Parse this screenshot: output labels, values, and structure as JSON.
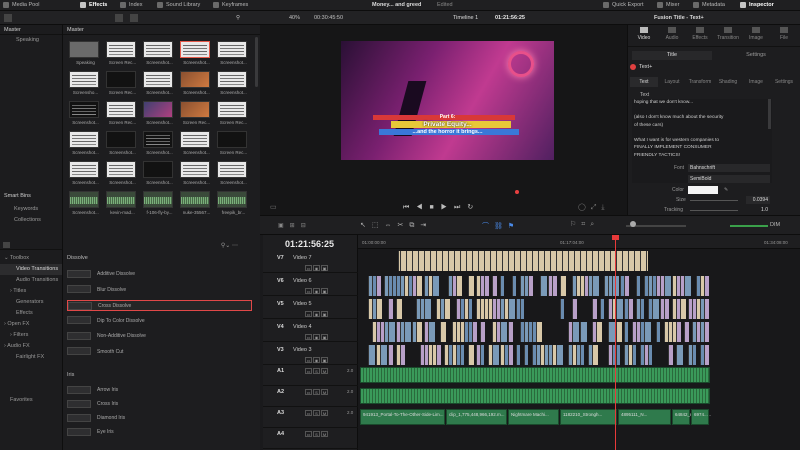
{
  "topbar": {
    "media_pool": "Media Pool",
    "effects": "Effects",
    "index": "Index",
    "sound_library": "Sound Library",
    "keyframes": "Keyframes",
    "project_title": "Money... and greed",
    "edited": "Edited",
    "quick_export": "Quick Export",
    "mixer": "Mixer",
    "metadata": "Metadata",
    "inspector": "Inspector"
  },
  "secbar": {
    "zoom": "40%",
    "timecode_left": "00:30:45:50",
    "timeline_name": "Timeline 1",
    "timecode_right": "01:21:56:25",
    "inspector_title": "Fusion Title - Text+"
  },
  "bins": {
    "master_header": "Master",
    "speaking": "Speaking",
    "smart_bins": "Smart Bins",
    "keywords": "Keywords",
    "collections": "Collections"
  },
  "pool": {
    "header": "Master",
    "clips": [
      "Speaking",
      "Screen Rec...",
      "Screenshot...",
      "Screenshot...",
      "Screenshot...",
      "Screensho...",
      "Screen Rec...",
      "Screenshot...",
      "Screenshot...",
      "Screenshot...",
      "Screenshot...",
      "Screen Rec...",
      "Screenshot...",
      "Screen Rec...",
      "Screen Rec...",
      "Screenshot...",
      "Screenshot...",
      "Screenshot...",
      "Screenshot...",
      "Screen Rec...",
      "Screenshot...",
      "Screenshot...",
      "Screenshot...",
      "Screenshot...",
      "Screenshot...",
      "Screenshot...",
      "kevin-mad...",
      "f-106-fly-by...",
      "nuke-35567...",
      "freepik_br..."
    ]
  },
  "viewer": {
    "line1": "Part 6:",
    "line2": "Private Equity...",
    "line3": "...and the horror it brings..."
  },
  "inspector": {
    "tabs": [
      "Video",
      "Audio",
      "Effects",
      "Transition",
      "Image",
      "File"
    ],
    "subtabs": [
      "Title",
      "Settings"
    ],
    "node_name": "Text+",
    "text_tabs": [
      "Text",
      "Layout",
      "Transform",
      "Shading",
      "Image",
      "Settings"
    ],
    "section": "Text",
    "body_lines": [
      "hoping that we don't know...",
      "",
      "(also I don't know much about the security",
      "of these cars)",
      "",
      "What I want is for western companies to",
      "FINALLY IMPLEMENT CONSUMER",
      "FRIENDLY TACTICS!"
    ],
    "font_label": "Font",
    "font_value": "Bahnschrift",
    "style_value": "SemiBold",
    "color_label": "Color",
    "size_label": "Size",
    "size_value": "0.0394",
    "tracking_label": "Tracking",
    "tracking_value": "1.0"
  },
  "toolrow": {
    "timecode": "01:21:56:25",
    "ruler": [
      "01:00:00:00",
      "01:17:04:00",
      "01:34:08:00"
    ],
    "dim": "DIM"
  },
  "effects": {
    "toolbox": "Toolbox",
    "video_transitions": "Video Transitions",
    "audio_transitions": "Audio Transitions",
    "titles": "Titles",
    "generators": "Generators",
    "effects_item": "Effects",
    "open_fx": "Open FX",
    "filters": "Filters",
    "audio_fx": "Audio FX",
    "fairlight_fx": "Fairlight FX",
    "favorites": "Favorites"
  },
  "transitions": {
    "dissolve_header": "Dissolve",
    "dissolve": [
      "Additive Dissolve",
      "Blur Dissolve",
      "Cross Dissolve",
      "Dip To Color Dissolve",
      "Non-Additive Dissolve",
      "Smooth Cut"
    ],
    "iris_header": "Iris",
    "iris": [
      "Arrow Iris",
      "Cross Iris",
      "Diamond Iris",
      "Eye Iris"
    ]
  },
  "tracks": {
    "video": [
      {
        "id": "V7",
        "name": "Video 7"
      },
      {
        "id": "V6",
        "name": "Video 6"
      },
      {
        "id": "V5",
        "name": "Video 5"
      },
      {
        "id": "V4",
        "name": "Video 4"
      },
      {
        "id": "V3",
        "name": "Video 3"
      }
    ],
    "audio": [
      {
        "id": "A1",
        "level": "2.0"
      },
      {
        "id": "A2",
        "level": "2.0"
      },
      {
        "id": "A3",
        "level": "2.0"
      },
      {
        "id": "A4",
        "level": ""
      }
    ],
    "a3_clips": [
      "941913_Portal-To-The-Other-Side-Lim...",
      "clip_1,775,448,966,192.m...",
      "Nightmare Machi...",
      "1182210_Strongh...",
      "4895111_N...",
      "64842_newgrou...",
      "6974..."
    ]
  }
}
